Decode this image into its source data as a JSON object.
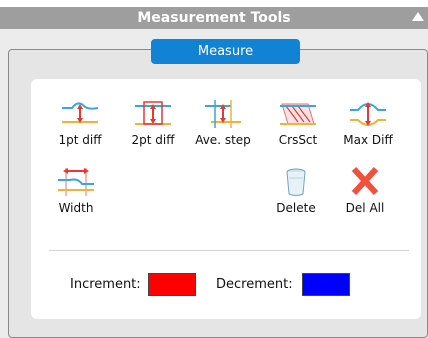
{
  "window": {
    "title": "Measurement Tools"
  },
  "measure_button": {
    "label": "Measure"
  },
  "tools": [
    {
      "label": "1pt diff",
      "icon": "one-point-diff-icon"
    },
    {
      "label": "2pt diff",
      "icon": "two-point-diff-icon"
    },
    {
      "label": "Ave. step",
      "icon": "average-step-icon"
    },
    {
      "label": "CrsSct",
      "icon": "cross-section-icon"
    },
    {
      "label": "Max Diff",
      "icon": "max-diff-icon"
    },
    {
      "label": "Width",
      "icon": "width-icon"
    },
    {
      "label": "Delete",
      "icon": "trash-icon"
    },
    {
      "label": "Del All",
      "icon": "delete-all-x-icon"
    }
  ],
  "legend": {
    "increment_label": "Increment:",
    "increment_color": "#ff0000",
    "decrement_label": "Decrement:",
    "decrement_color": "#0000ff"
  }
}
